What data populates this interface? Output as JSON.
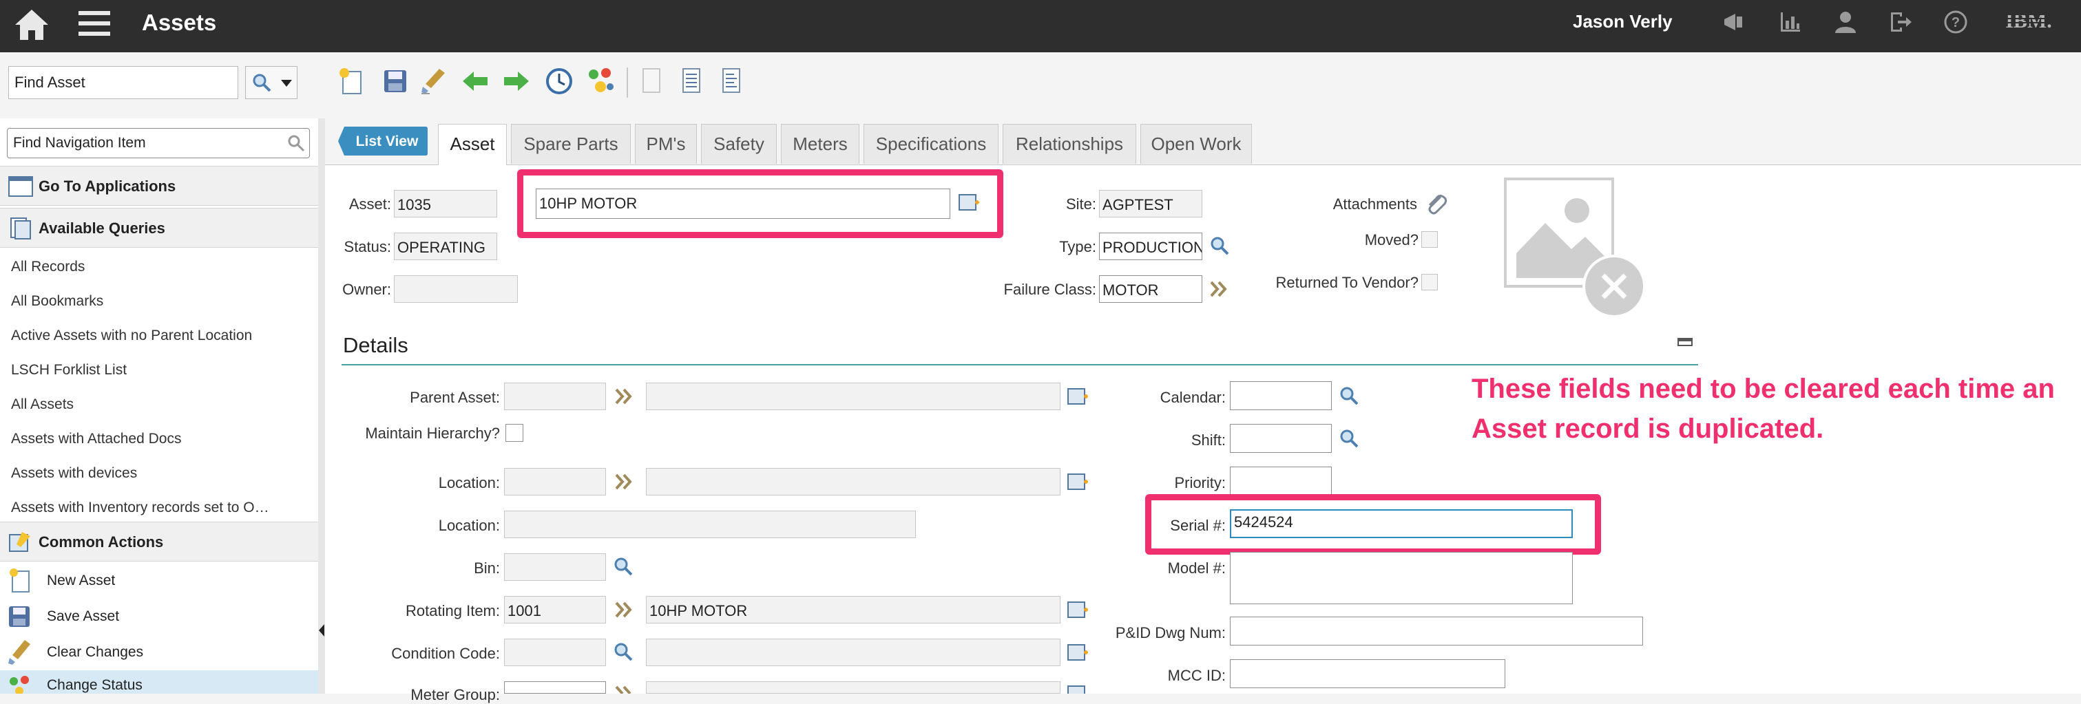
{
  "header": {
    "app_title": "Assets",
    "user_name": "Jason Verly",
    "logo_text": "IBM",
    "icons": [
      "home-icon",
      "menu-icon",
      "broadcast-icon",
      "reports-icon",
      "profile-icon",
      "signout-icon",
      "help-icon"
    ]
  },
  "toolbar": {
    "find_asset_value": "Find Asset",
    "icons": [
      "new-record-icon",
      "save-icon",
      "clear-changes-icon",
      "previous-record-icon",
      "next-record-icon",
      "history-icon",
      "change-status-icon",
      "document-icon",
      "document-list-icon",
      "document-report-icon"
    ]
  },
  "nav": {
    "find_nav_value": "Find Navigation Item",
    "go_to_applications": "Go To Applications",
    "available_queries": "Available Queries",
    "queries": [
      "All Records",
      "All Bookmarks",
      "Active Assets with no Parent Location",
      "LSCH Forklist List",
      "All Assets",
      "Assets with Attached Docs",
      "Assets with devices",
      "Assets with Inventory records set to O…"
    ],
    "common_actions": "Common Actions",
    "actions": [
      "New Asset",
      "Save Asset",
      "Clear Changes",
      "Change Status"
    ]
  },
  "tabs": {
    "list_view": "List View",
    "items": [
      "Asset",
      "Spare Parts",
      "PM's",
      "Safety",
      "Meters",
      "Specifications",
      "Relationships",
      "Open Work"
    ],
    "active": "Asset"
  },
  "asset": {
    "asset_label": "Asset:",
    "asset_value": "1035",
    "description": "10HP MOTOR",
    "status_label": "Status:",
    "status_value": "OPERATING",
    "owner_label": "Owner:",
    "owner_value": "",
    "site_label": "Site:",
    "site_value": "AGPTEST",
    "type_label": "Type:",
    "type_value": "PRODUCTION",
    "failure_class_label": "Failure Class:",
    "failure_class_value": "MOTOR",
    "attachments_label": "Attachments",
    "moved_label": "Moved?",
    "returned_label": "Returned To Vendor?"
  },
  "details": {
    "title": "Details",
    "parent_asset_label": "Parent Asset:",
    "maintain_hierarchy_label": "Maintain Hierarchy?",
    "location_label": "Location:",
    "location2_label": "Location:",
    "bin_label": "Bin:",
    "rotating_item_label": "Rotating Item:",
    "rotating_item_value": "1001",
    "rotating_item_desc": "10HP MOTOR",
    "condition_code_label": "Condition Code:",
    "meter_group_label": "Meter Group:",
    "calendar_label": "Calendar:",
    "shift_label": "Shift:",
    "priority_label": "Priority:",
    "serial_label": "Serial #:",
    "serial_value": "5424524",
    "model_label": "Model #:",
    "pid_label": "P&ID Dwg Num:",
    "mcc_label": "MCC ID:"
  },
  "annotation": {
    "note": "These fields need to be cleared each time an Asset record is duplicated.",
    "highlight_color": "#f0306e"
  },
  "colors": {
    "header_bg": "#2e2e2e",
    "accent_teal": "#4aa3a3",
    "list_view_blue": "#3b8fc0"
  }
}
